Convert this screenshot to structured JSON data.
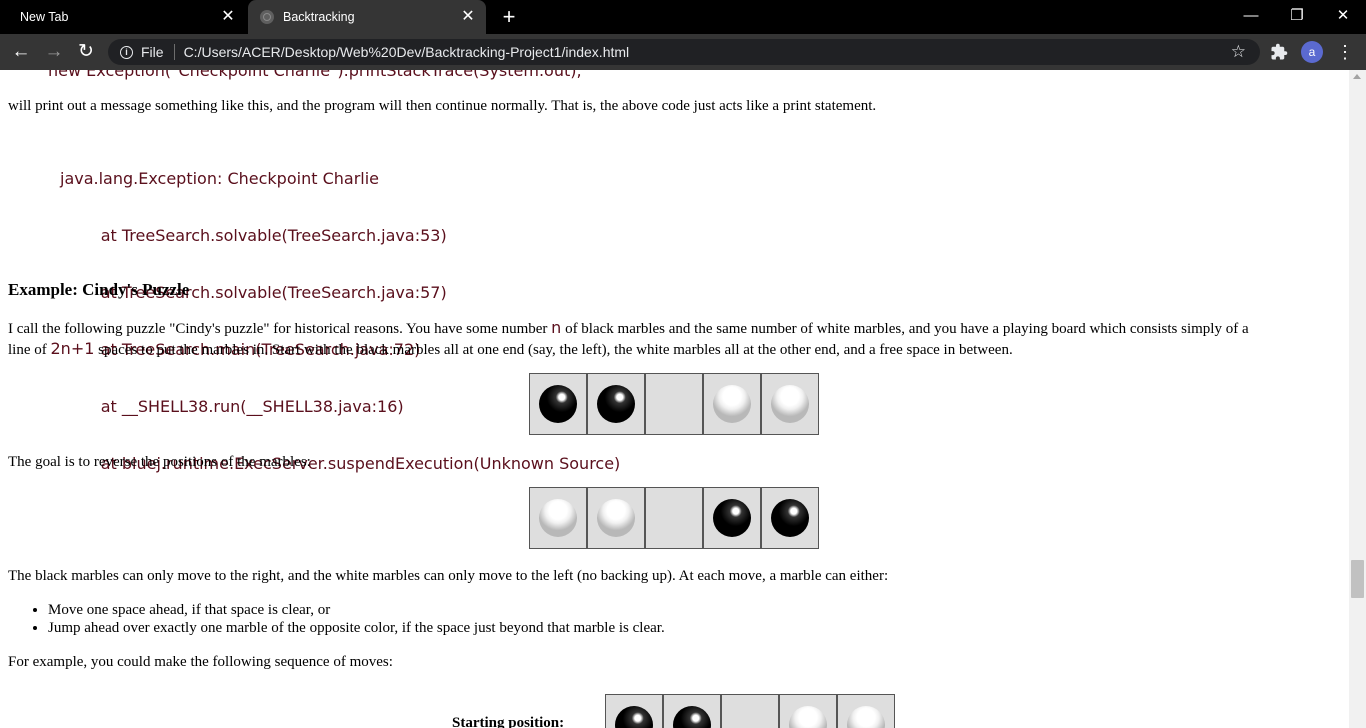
{
  "browser": {
    "tabs": [
      {
        "title": "New Tab"
      },
      {
        "title": "Backtracking"
      }
    ],
    "address": {
      "scheme": "File",
      "url": "C:/Users/ACER/Desktop/Web%20Dev/Backtracking-Project1/index.html"
    },
    "profile_initial": "a"
  },
  "page": {
    "code_top_partial": "new Exception(\"Checkpoint Charlie\").printStackTrace(System.out);",
    "intro_after_code": "will print out a message something like this, and the program will then continue normally. That is, the above code just acts like a print statement.",
    "stack_trace": [
      "java.lang.Exception: Checkpoint Charlie",
      "        at TreeSearch.solvable(TreeSearch.java:53)",
      "        at TreeSearch.solvable(TreeSearch.java:57)",
      "        at TreeSearch.main(TreeSearch.java:72)",
      "        at __SHELL38.run(__SHELL38.java:16)",
      "        at bluej.runtime.ExecServer.suspendExecution(Unknown Source)"
    ],
    "example_heading": "Example: Cindy's Puzzle",
    "puzzle_intro": {
      "part1": "I call the following puzzle \"Cindy's puzzle\" for historical reasons. You have some number ",
      "var_n": "n",
      "part2": " of black marbles and the same number of white marbles, and you have a playing board which consists simply of a",
      "part3": "line of ",
      "var_2n1": "2n+1",
      "part4": " spaces to put the marbles in. Start with the black marbles all at one end (say, the left), the white marbles all at the other end, and a free space in between."
    },
    "board_start": [
      "black",
      "black",
      "empty",
      "white",
      "white"
    ],
    "goal_text": "The goal is to reverse the positions of the marbles:",
    "board_goal": [
      "white",
      "white",
      "empty",
      "black",
      "black"
    ],
    "moves_text": "The black marbles can only move to the right, and the white marbles can only move to the left (no backing up). At each move, a marble can either:",
    "rules": [
      "Move one space ahead, if that space is clear, or",
      "Jump ahead over exactly one marble of the opposite color, if the space just beyond that marble is clear."
    ],
    "example_text": "For example, you could make the following sequence of moves:",
    "starting_label": "Starting position:",
    "board_sequence_start": [
      "black",
      "black",
      "empty",
      "white",
      "white"
    ]
  }
}
